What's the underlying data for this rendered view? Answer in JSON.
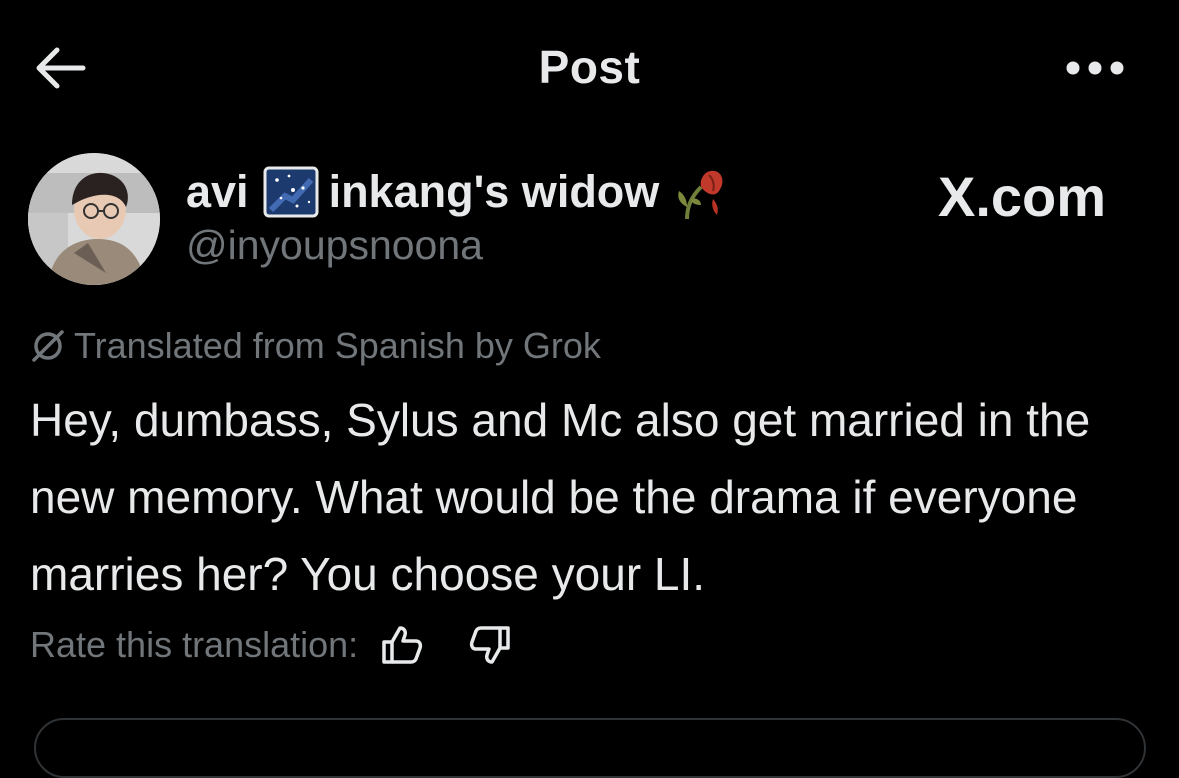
{
  "header": {
    "title": "Post"
  },
  "author": {
    "name_part1": "avi",
    "name_part2": "inkang's widow",
    "handle": "@inyoupsnoona"
  },
  "watermark": "X.com",
  "post": {
    "translation_note": "Translated from Spanish by Grok",
    "text": "Hey, dumbass, Sylus and Mc also get married in the new memory. What would be the drama if everyone marries her? You choose your LI.",
    "rate_label": "Rate this translation:"
  },
  "colors": {
    "background": "#000000",
    "text_primary": "#e7e9ea",
    "text_secondary": "#71767b",
    "border": "#2f3336"
  },
  "icons": {
    "back": "arrow-left-icon",
    "more": "more-dots-icon",
    "grok": "grok-slash-icon",
    "thumb_up": "thumb-up-icon",
    "thumb_down": "thumb-down-icon"
  }
}
